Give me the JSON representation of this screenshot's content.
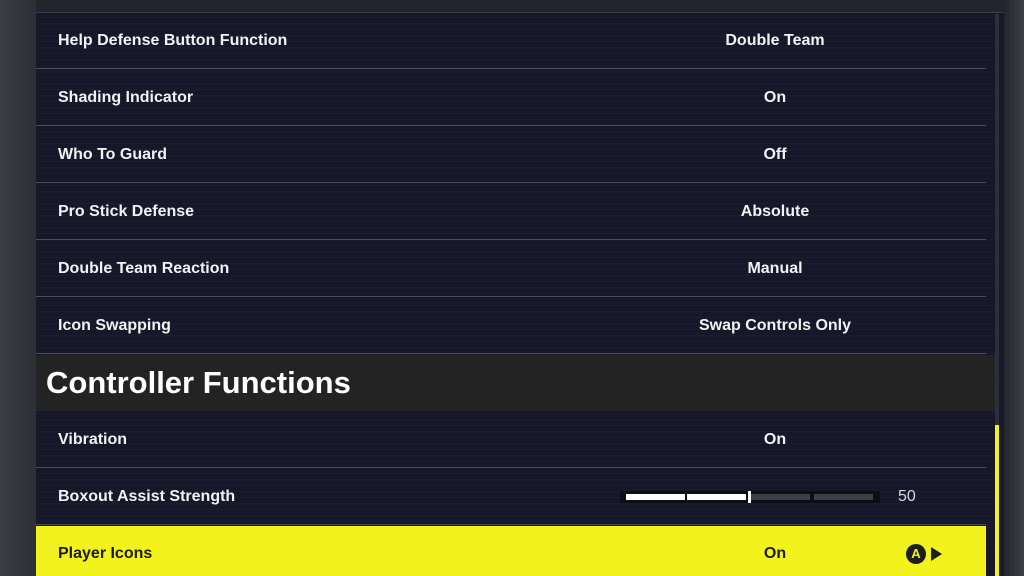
{
  "settings_top": [
    {
      "label": "Help Defense Button Function",
      "value": "Double Team"
    },
    {
      "label": "Shading Indicator",
      "value": "On"
    },
    {
      "label": "Who To Guard",
      "value": "Off"
    },
    {
      "label": "Pro Stick Defense",
      "value": "Absolute"
    },
    {
      "label": "Double Team Reaction",
      "value": "Manual"
    },
    {
      "label": "Icon Swapping",
      "value": "Swap Controls Only"
    }
  ],
  "section": {
    "title": "Controller Functions"
  },
  "controller_settings": {
    "vibration": {
      "label": "Vibration",
      "value": "On"
    },
    "boxout": {
      "label": "Boxout Assist Strength",
      "value": "50",
      "fill_fraction": 0.5
    },
    "player_icons": {
      "label": "Player Icons",
      "value": "On",
      "button_glyph": "A"
    }
  },
  "icons": {
    "confirm": "a-button-icon",
    "next": "arrow-right-icon"
  },
  "colors": {
    "highlight": "#f2f21d",
    "panel": "#17172a",
    "section_header": "#232323",
    "text": "#f2f2f2"
  }
}
